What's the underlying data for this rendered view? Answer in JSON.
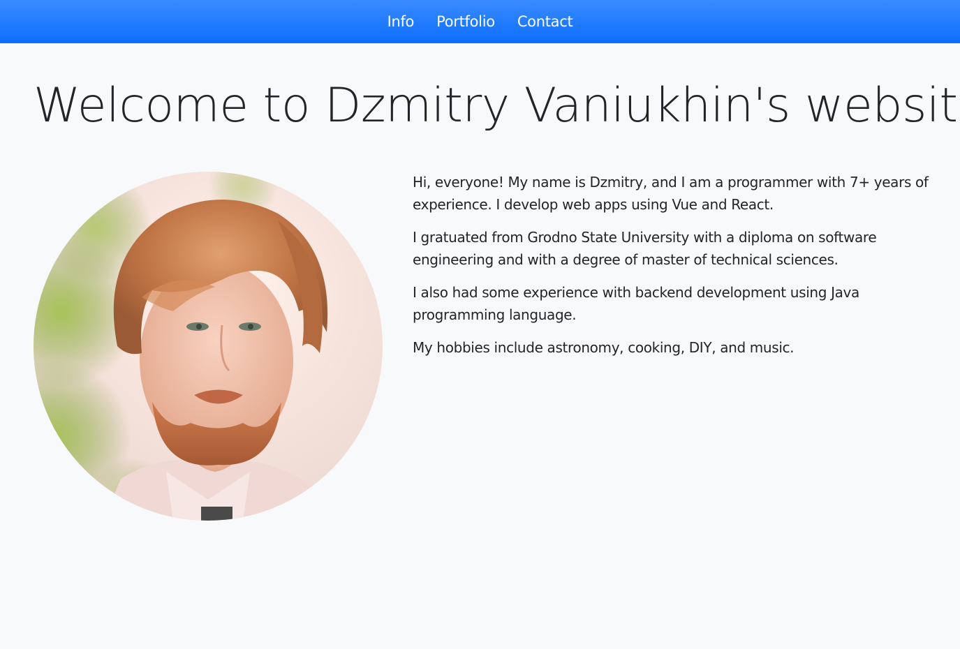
{
  "nav": {
    "items": [
      {
        "label": "Info"
      },
      {
        "label": "Portfolio"
      },
      {
        "label": "Contact"
      }
    ]
  },
  "header": {
    "title": "Welcome to Dzmitry Vaniukhin's website!"
  },
  "profile": {
    "avatar_icon": "portrait-photo"
  },
  "bio": {
    "paragraphs": [
      "Hi, everyone! My name is Dzmitry, and I am a programmer with 7+ years of experience. I develop web apps using Vue and React.",
      "I gratuated from Grodno State University with a diploma on software engineering and with a degree of master of technical sciences.",
      "I also had some experience with backend development using Java programming language.",
      "My hobbies include astronomy, cooking, DIY, and music."
    ]
  },
  "colors": {
    "navbar": "#0d6efd",
    "background": "#f8f9fa",
    "text": "#212529"
  }
}
